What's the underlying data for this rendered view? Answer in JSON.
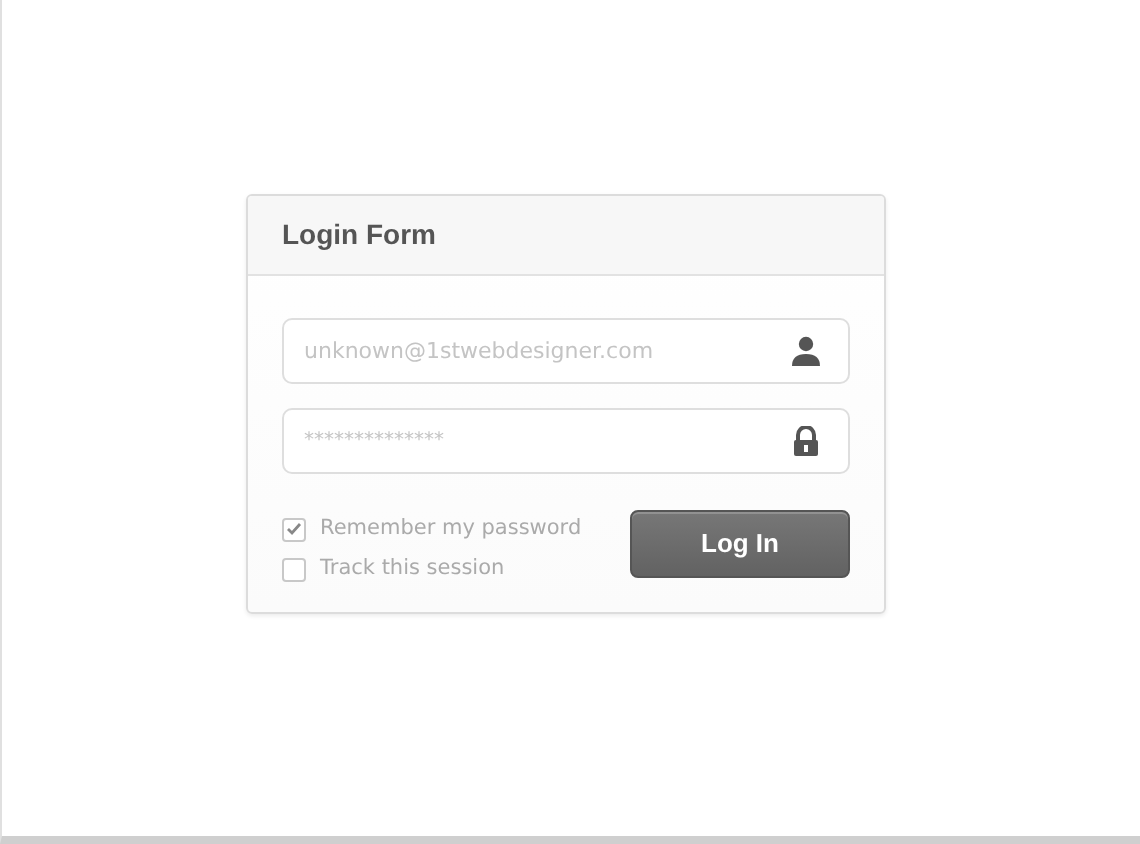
{
  "login_form": {
    "title": "Login Form",
    "email_field": {
      "placeholder": "unknown@1stwebdesigner.com"
    },
    "password_field": {
      "placeholder": "**************"
    },
    "options": [
      {
        "label": "Remember my password",
        "checked": true
      },
      {
        "label": "Track this session",
        "checked": false
      }
    ],
    "submit_button": "Log In"
  }
}
